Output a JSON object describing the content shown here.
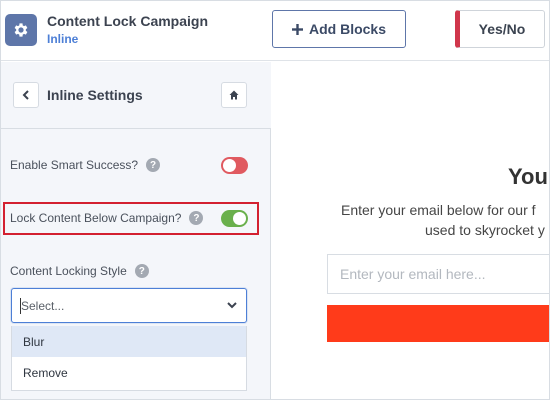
{
  "header": {
    "campaign_name": "Content Lock Campaign",
    "campaign_type": "Inline",
    "add_blocks_label": "Add Blocks",
    "add_blocks_icon": "plus-icon",
    "yesno_label": "Yes/No",
    "settings_icon": "gear-icon"
  },
  "sidebar": {
    "title": "Inline Settings",
    "back_icon": "chevron-left-icon",
    "home_icon": "home-icon",
    "smart_success": {
      "label": "Enable Smart Success?",
      "help": "?",
      "enabled": false
    },
    "lock_content": {
      "label": "Lock Content Below Campaign?",
      "help": "?",
      "enabled": true
    },
    "locking_style": {
      "label": "Content Locking Style",
      "help": "?",
      "placeholder": "Select...",
      "options": [
        "Blur",
        "Remove"
      ],
      "highlighted_option": "Blur"
    }
  },
  "preview": {
    "heading": "You",
    "subtext_line1": "Enter your email below for our f",
    "subtext_line2": "used to skyrocket y",
    "email_placeholder": "Enter your email here..."
  },
  "colors": {
    "accent": "#4d7fd6",
    "gear_bg": "#5e76a9",
    "toggle_off": "#e05a60",
    "toggle_on": "#6ab04c",
    "highlight": "#d32030",
    "cta": "#ff3b1a"
  }
}
